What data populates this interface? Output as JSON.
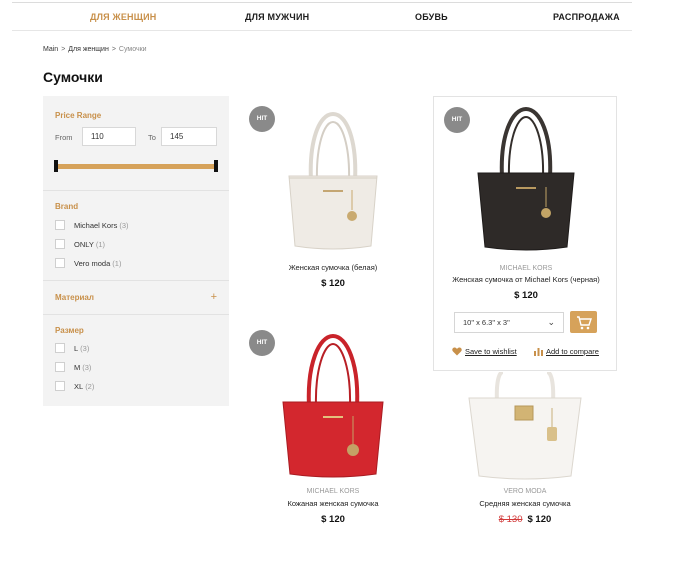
{
  "nav": {
    "items": [
      {
        "label": "ДЛЯ ЖЕНЩИН",
        "active": true
      },
      {
        "label": "ДЛЯ МУЖЧИН",
        "active": false
      },
      {
        "label": "ОБУВЬ",
        "active": false
      },
      {
        "label": "РАСПРОДАЖА",
        "active": false
      }
    ]
  },
  "breadcrumb": {
    "items": [
      "Main",
      "Для женщин",
      "Сумочки"
    ],
    "separator": ">"
  },
  "page_title": "Сумочки",
  "filters": {
    "price_range": {
      "title": "Price Range",
      "from_label": "From",
      "from_value": "110",
      "to_label": "To",
      "to_value": "145"
    },
    "brand": {
      "title": "Brand",
      "options": [
        {
          "label": "Michael Kors",
          "count": "(3)"
        },
        {
          "label": "ONLY",
          "count": "(1)"
        },
        {
          "label": "Vero moda",
          "count": "(1)"
        }
      ]
    },
    "material": {
      "title": "Материал",
      "expand_symbol": "+"
    },
    "size": {
      "title": "Размер",
      "options": [
        {
          "label": "L",
          "count": "(3)"
        },
        {
          "label": "M",
          "count": "(3)"
        },
        {
          "label": "XL",
          "count": "(2)"
        }
      ]
    }
  },
  "products": [
    {
      "badge": "HIT",
      "brand": "",
      "name": "Женская сумочка (белая)",
      "price": "$ 120",
      "bag_color": "#eeeae4"
    },
    {
      "badge": "HIT",
      "brand": "MICHAEL KORS",
      "name": "Женская сумочка от Michael Kors (черная)",
      "price": "$ 120",
      "bag_color": "#2e2a28",
      "size_value": "10\" x 6.3\" x 3\"",
      "wishlist_label": "Save to wishlist",
      "compare_label": "Add to compare"
    },
    {
      "badge": "HIT",
      "brand": "MICHAEL KORS",
      "name": "Кожаная женская сумочка",
      "price": "$ 120",
      "bag_color": "#d3272e"
    },
    {
      "badge": "",
      "brand": "VERO MODA",
      "name": "Средняя женская сумочка",
      "old_price": "$ 130",
      "price": "$ 120",
      "bag_color": "#f4f2ef"
    }
  ],
  "colors": {
    "accent": "#c8904a",
    "slider": "#d6a25a",
    "badge": "#8a8a8a",
    "old_price": "#d23a3a"
  }
}
